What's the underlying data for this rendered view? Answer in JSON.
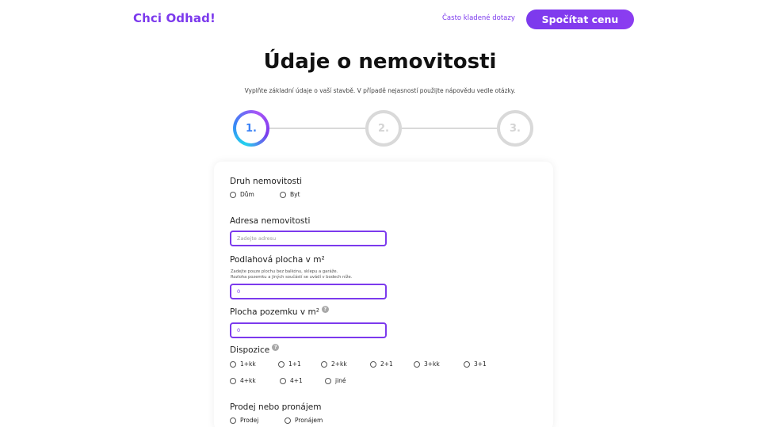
{
  "header": {
    "logo": "Chci Odhad!",
    "faq_link": "Často kladené dotazy",
    "cta_button": "Spočítat cenu"
  },
  "page": {
    "title": "Údaje o nemovitosti",
    "subtitle": "Vyplňte základní údaje o vaší stavbě. V případě nejasností použijte nápovědu vedle otázky."
  },
  "stepper": {
    "steps": [
      "1.",
      "2.",
      "3."
    ],
    "active_step": "1."
  },
  "form": {
    "property_type": {
      "label": "Druh nemovitosti",
      "options": [
        "Dům",
        "Byt"
      ]
    },
    "address": {
      "label": "Adresa nemovitosti",
      "placeholder": "Zadejte adresu"
    },
    "floor_area": {
      "label": "Podlahová plocha v m²",
      "hint_line1": "Zadejte pouze plochu bez balkónu, sklepu a garáže.",
      "hint_line2": "Rozloha pozemku a jiných součástí se uvádí v bodech níže.",
      "value": "0"
    },
    "land_area": {
      "label": "Plocha pozemku v m²",
      "value": "0",
      "help_icon": "?"
    },
    "layout": {
      "label": "Dispozice",
      "help_icon": "?",
      "options": [
        "1+kk",
        "1+1",
        "2+kk",
        "2+1",
        "3+kk",
        "3+1",
        "4+kk",
        "4+1",
        "jiné"
      ]
    },
    "transaction": {
      "label": "Prodej nebo pronájem",
      "options": [
        "Prodej",
        "Pronájem"
      ]
    }
  },
  "colors": {
    "accent": "#7c3aed",
    "step_gradient_start": "#22d3ee",
    "inactive_step": "#d9d9d9"
  }
}
